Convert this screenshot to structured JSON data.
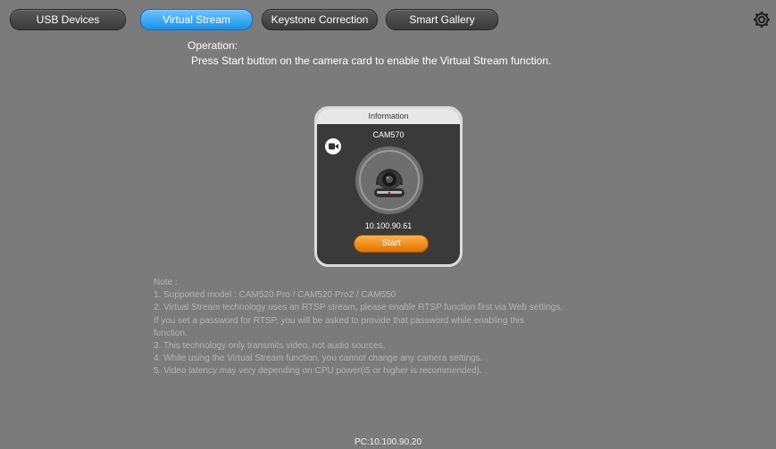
{
  "tabs": [
    {
      "label": "USB Devices",
      "active": false
    },
    {
      "label": "Virtual Stream",
      "active": true
    },
    {
      "label": "Keystone Correction",
      "active": false
    },
    {
      "label": "Smart Gallery",
      "active": false
    }
  ],
  "settings_icon": "gear-icon",
  "operation": {
    "title": "Operation:",
    "text": "Press Start button on the camera card to enable the Virtual Stream function."
  },
  "card": {
    "header": "Information",
    "model": "CAM570",
    "ip": "10.100.90.61",
    "start_label": "Start",
    "toggle_icon": "video-camera-icon",
    "image_icon": "ptz-camera-icon"
  },
  "notes": {
    "title": "Note :",
    "lines": [
      " 1. Supported model : CAM520 Pro / CAM520 Pro2 / CAM550",
      " 2. Virtual Stream technology uses an RTSP stream, please enable RTSP function first via Web settings.",
      "    If you set a password for RTSP, you will be asked to provide that password while enabling this",
      "function.",
      " 3. This technology only transmits video, not audio sources.",
      " 4. While using the Virtual Stream function, you cannot change any camera settings.",
      " 5. Video latency may very depending on CPU power(i5 or higher is recommended)."
    ]
  },
  "footer": {
    "pc_ip": "PC:10.100.90.20"
  },
  "colors": {
    "background": "#7b7b7b",
    "active_tab": "#1a8fe8",
    "start_button": "#f08a10"
  }
}
